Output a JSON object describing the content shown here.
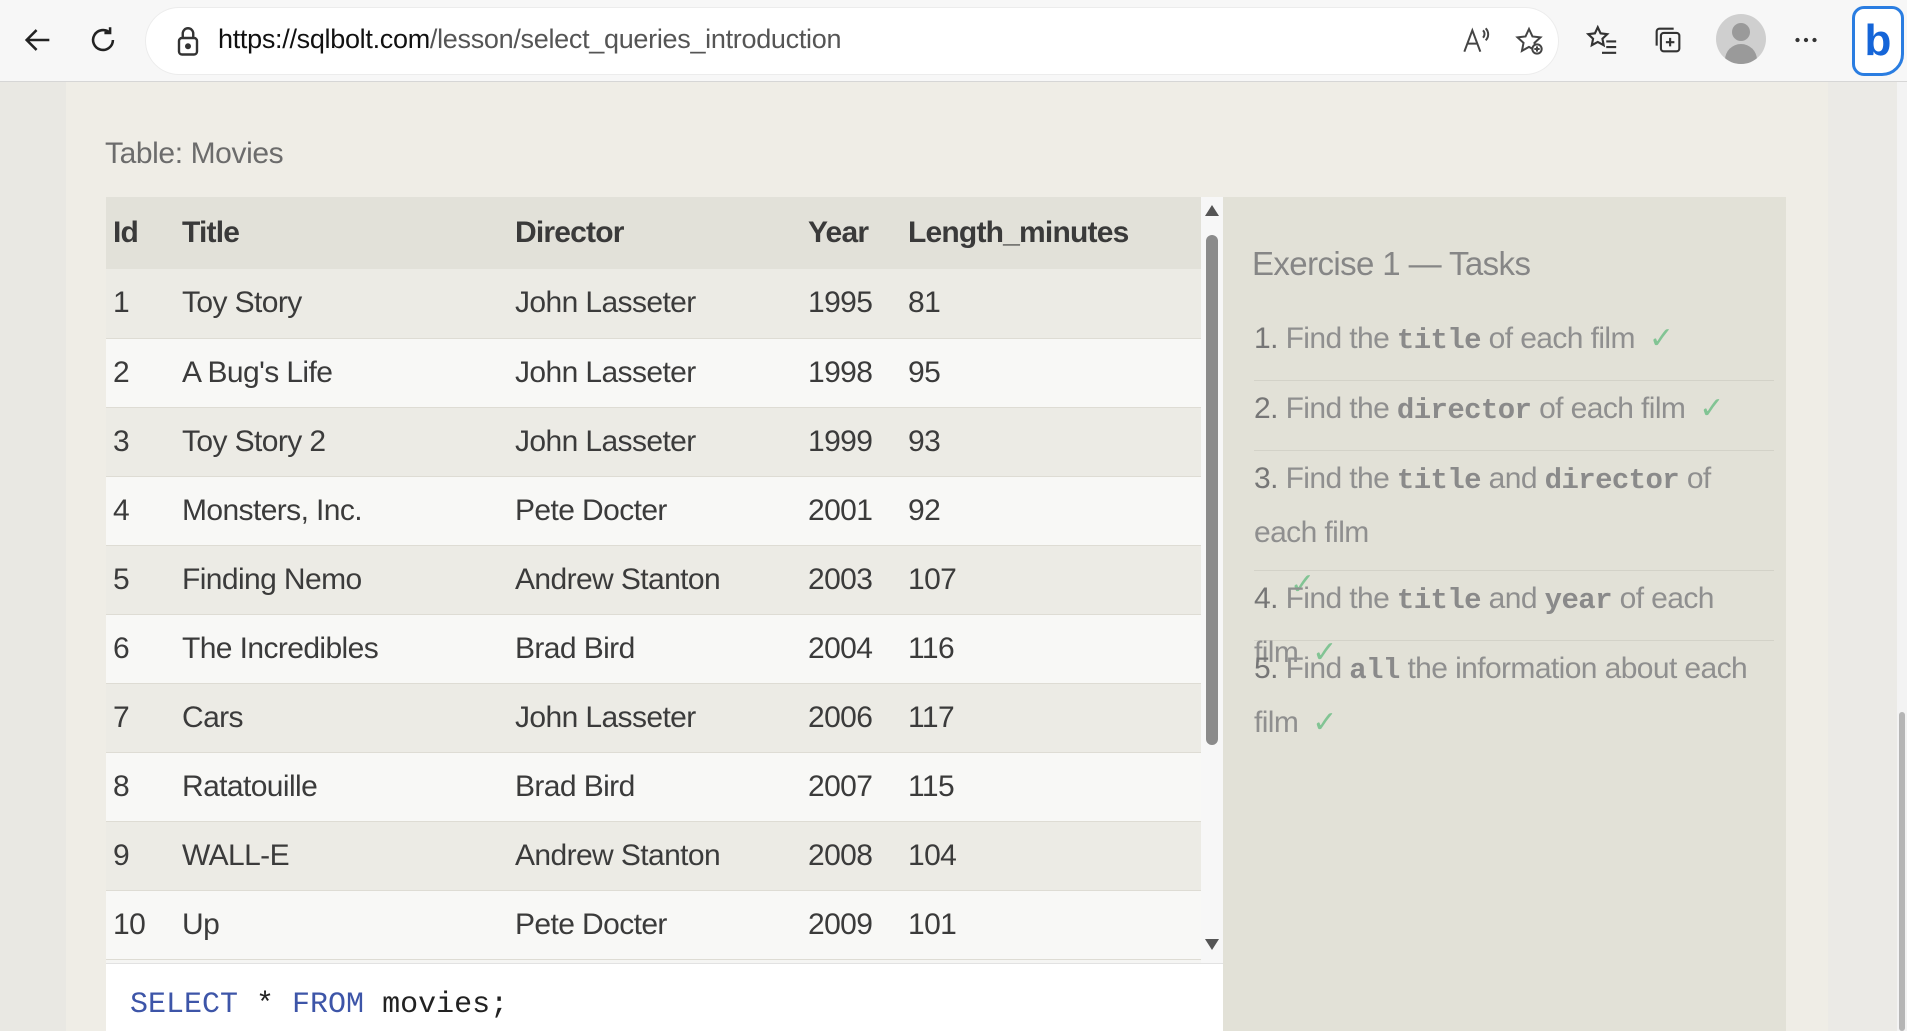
{
  "browser": {
    "url_host": "https://sqlbolt.com",
    "url_path": "/lesson/select_queries_introduction"
  },
  "page": {
    "table_caption": "Table: Movies",
    "table": {
      "columns": [
        "Id",
        "Title",
        "Director",
        "Year",
        "Length_minutes"
      ],
      "rows": [
        [
          "1",
          "Toy Story",
          "John Lasseter",
          "1995",
          "81"
        ],
        [
          "2",
          "A Bug's Life",
          "John Lasseter",
          "1998",
          "95"
        ],
        [
          "3",
          "Toy Story 2",
          "John Lasseter",
          "1999",
          "93"
        ],
        [
          "4",
          "Monsters, Inc.",
          "Pete Docter",
          "2001",
          "92"
        ],
        [
          "5",
          "Finding Nemo",
          "Andrew Stanton",
          "2003",
          "107"
        ],
        [
          "6",
          "The Incredibles",
          "Brad Bird",
          "2004",
          "116"
        ],
        [
          "7",
          "Cars",
          "John Lasseter",
          "2006",
          "117"
        ],
        [
          "8",
          "Ratatouille",
          "Brad Bird",
          "2007",
          "115"
        ],
        [
          "9",
          "WALL-E",
          "Andrew Stanton",
          "2008",
          "104"
        ],
        [
          "10",
          "Up",
          "Pete Docter",
          "2009",
          "101"
        ]
      ]
    },
    "query": {
      "kw_select": "SELECT",
      "star": " * ",
      "kw_from": "FROM",
      "rest": " movies;"
    }
  },
  "exercise": {
    "title": "Exercise 1 — Tasks",
    "check": "✓",
    "tasks": [
      {
        "num": "1.",
        "pre": "Find the ",
        "code1": "title",
        "mid": "",
        "code2": "",
        "post": " of each film"
      },
      {
        "num": "2.",
        "pre": "Find the ",
        "code1": "director",
        "mid": "",
        "code2": "",
        "post": " of each film"
      },
      {
        "num": "3.",
        "pre": "Find the ",
        "code1": "title",
        "mid": " and ",
        "code2": "director",
        "post": " of each film"
      },
      {
        "num": "4.",
        "pre": "Find the ",
        "code1": "title",
        "mid": " and ",
        "code2": "year",
        "post": " of each film"
      },
      {
        "num": "5.",
        "pre": "Find ",
        "code1": "all",
        "mid": "",
        "code2": "",
        "post": " the information about each film"
      }
    ]
  },
  "colors": {
    "check_green": "#82c494",
    "keyword_blue": "#3d55a8",
    "bing_blue": "#1565d8"
  },
  "icons": [
    "back-icon",
    "refresh-icon",
    "lock-icon",
    "read-aloud-icon",
    "add-favorite-icon",
    "favorites-icon",
    "collections-icon",
    "profile-icon",
    "more-icon",
    "bing-icon"
  ]
}
